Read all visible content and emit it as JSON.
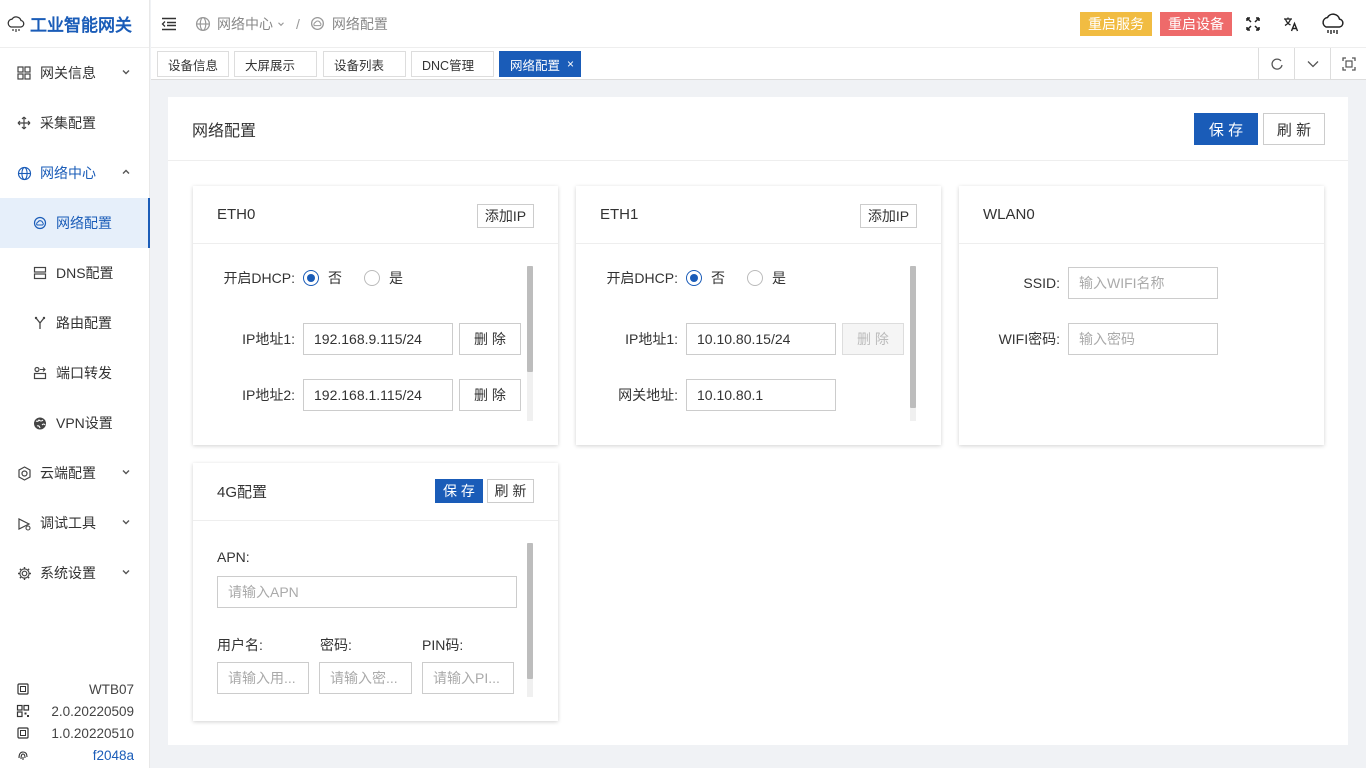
{
  "app": {
    "title": "工业智能网关"
  },
  "sidebar": {
    "items": [
      {
        "label": "网关信息"
      },
      {
        "label": "采集配置"
      },
      {
        "label": "网络中心"
      },
      {
        "label": "网络配置"
      },
      {
        "label": "DNS配置"
      },
      {
        "label": "路由配置"
      },
      {
        "label": "端口转发"
      },
      {
        "label": "VPN设置"
      },
      {
        "label": "云端配置"
      },
      {
        "label": "调试工具"
      },
      {
        "label": "系统设置"
      }
    ],
    "footer": {
      "model": "WTB07",
      "version1": "2.0.20220509",
      "version2": "1.0.20220510",
      "hash": "f2048a"
    }
  },
  "header": {
    "breadcrumb": [
      "网络中心",
      "网络配置"
    ],
    "restart_service": "重启服务",
    "restart_device": "重启设备"
  },
  "tabs": [
    {
      "label": "设备信息"
    },
    {
      "label": "大屏展示"
    },
    {
      "label": "设备列表"
    },
    {
      "label": "DNC管理"
    },
    {
      "label": "网络配置",
      "close": "×"
    }
  ],
  "main": {
    "title": "网络配置",
    "save": "保 存",
    "refresh": "刷 新"
  },
  "eth0": {
    "title": "ETH0",
    "add_ip": "添加IP",
    "dhcp_label": "开启DHCP:",
    "no": "否",
    "yes": "是",
    "ip1_label": "IP地址1:",
    "ip1": "192.168.9.115/24",
    "ip2_label": "IP地址2:",
    "ip2": "192.168.1.115/24",
    "delete": "删 除"
  },
  "eth1": {
    "title": "ETH1",
    "add_ip": "添加IP",
    "dhcp_label": "开启DHCP:",
    "no": "否",
    "yes": "是",
    "ip1_label": "IP地址1:",
    "ip1": "10.10.80.15/24",
    "gateway_label": "网关地址:",
    "gateway": "10.10.80.1",
    "delete": "删 除"
  },
  "wlan0": {
    "title": "WLAN0",
    "ssid_label": "SSID:",
    "ssid_placeholder": "输入WIFI名称",
    "pwd_label": "WIFI密码:",
    "pwd_placeholder": "输入密码"
  },
  "g4": {
    "title": "4G配置",
    "save": "保 存",
    "refresh": "刷 新",
    "apn_label": "APN:",
    "apn_placeholder": "请输入APN",
    "user_label": "用户名:",
    "user_placeholder": "请输入用...",
    "pwd_label": "密码:",
    "pwd_placeholder": "请输入密...",
    "pin_label": "PIN码:",
    "pin_placeholder": "请输入PI..."
  },
  "colors": {
    "primary": "#1a5cb8",
    "warning": "#f1bc42",
    "danger": "#ee6a6a"
  }
}
